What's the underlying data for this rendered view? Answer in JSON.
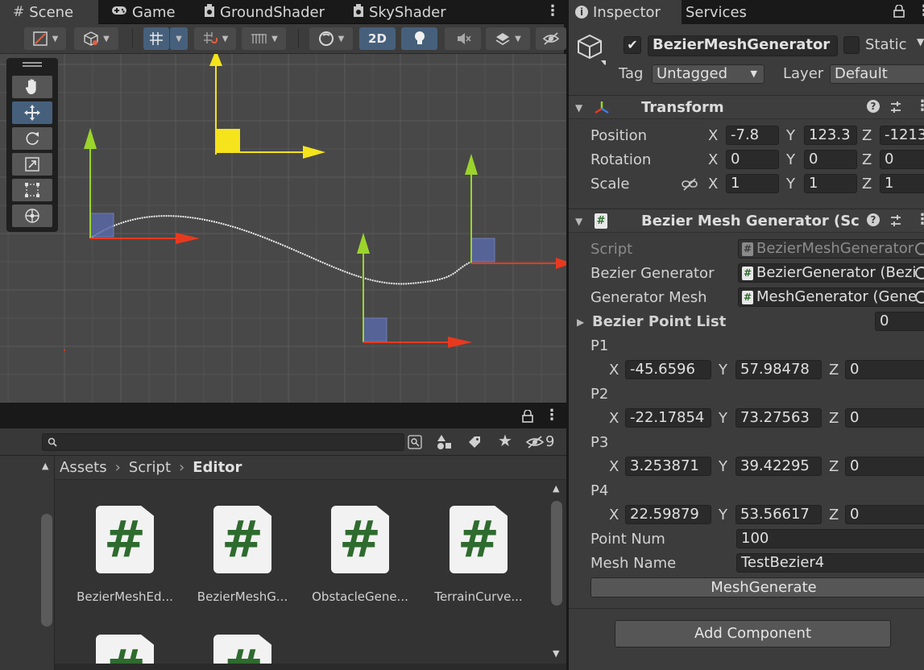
{
  "scene_tabs": [
    {
      "label": "Scene",
      "icon": "hash-icon"
    },
    {
      "label": "Game",
      "icon": "gamepad-icon"
    },
    {
      "label": "GroundShader",
      "icon": "shader-icon"
    },
    {
      "label": "SkyShader",
      "icon": "shader-icon"
    }
  ],
  "scene_toolbar": {
    "mode_2d_label": "2D"
  },
  "project": {
    "breadcrumb": [
      "Assets",
      "Script",
      "Editor"
    ],
    "hidden_count": "9",
    "assets": [
      {
        "name": "BezierMeshEd..."
      },
      {
        "name": "BezierMeshG..."
      },
      {
        "name": "ObstacleGene..."
      },
      {
        "name": "TerrainCurve..."
      }
    ]
  },
  "inspector": {
    "tabs": [
      "Inspector",
      "Services"
    ],
    "object_name": "BezierMeshGenerator",
    "static_label": "Static",
    "tag_label": "Tag",
    "tag_value": "Untagged",
    "layer_label": "Layer",
    "layer_value": "Default",
    "transform": {
      "title": "Transform",
      "position_label": "Position",
      "rotation_label": "Rotation",
      "scale_label": "Scale",
      "position": {
        "x": "-7.8",
        "y": "123.3",
        "z": "-1213"
      },
      "rotation": {
        "x": "0",
        "y": "0",
        "z": "0"
      },
      "scale": {
        "x": "1",
        "y": "1",
        "z": "1"
      }
    },
    "bezier_component": {
      "title": "Bezier Mesh Generator (Scrip",
      "script_label": "Script",
      "script_value": "BezierMeshGenerator",
      "bezier_generator_label": "Bezier Generator",
      "bezier_generator_value": "BezierGenerator (Bezi",
      "generator_mesh_label": "Generator Mesh",
      "generator_mesh_value": "MeshGenerator (Gene",
      "point_list_label": "Bezier Point List",
      "point_list_count": "0",
      "points": [
        {
          "label": "P1",
          "x": "-45.6596",
          "y": "57.98478",
          "z": "0"
        },
        {
          "label": "P2",
          "x": "-22.17854",
          "y": "73.27563",
          "z": "0"
        },
        {
          "label": "P3",
          "x": "3.253871",
          "y": "39.42295",
          "z": "0"
        },
        {
          "label": "P4",
          "x": "22.59879",
          "y": "53.56617",
          "z": "0"
        }
      ],
      "point_num_label": "Point Num",
      "point_num_value": "100",
      "mesh_name_label": "Mesh Name",
      "mesh_name_value": "TestBezier4",
      "generate_button": "MeshGenerate"
    },
    "add_component_button": "Add Component"
  },
  "axis_labels": {
    "x": "X",
    "y": "Y",
    "z": "Z"
  },
  "colors": {
    "accent_blue": "#46607c",
    "gizmo_x": "#e8391f",
    "gizmo_y": "#9bd42b",
    "gizmo_selected": "#f5e31c"
  }
}
